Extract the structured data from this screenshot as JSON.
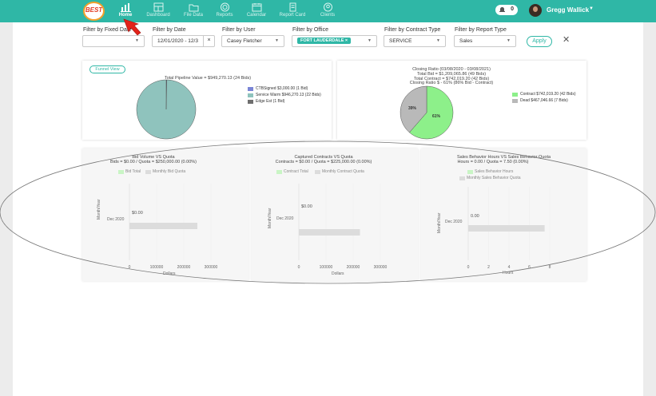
{
  "app": {
    "logo_text": "BEST",
    "nav": [
      {
        "label": "Home",
        "icon": "home-chart-icon",
        "active": true
      },
      {
        "label": "Dashboard",
        "icon": "dashboard-icon"
      },
      {
        "label": "File Data",
        "icon": "folder-icon"
      },
      {
        "label": "Reports",
        "icon": "reports-icon"
      },
      {
        "label": "Calendar",
        "icon": "calendar-icon"
      },
      {
        "label": "Report Card",
        "icon": "report-card-icon"
      },
      {
        "label": "Clients",
        "icon": "clients-icon"
      }
    ],
    "notifications_count": "0",
    "user_name": "Gregg Wallick",
    "colors": {
      "accent": "#2fb7a6",
      "service_warm": "#8fc3bd",
      "contract": "#8df08a",
      "dead": "#b9b9b9",
      "ctb": "#7a85d6",
      "edge": "#6e6e6e"
    }
  },
  "filters": {
    "fixed_date": {
      "label": "Filter by Fixed Date",
      "value": ""
    },
    "date": {
      "label": "Filter by Date",
      "value": "12/01/2020 - 12/3",
      "clear": "×"
    },
    "user": {
      "label": "Filter by User",
      "value": "Casey Fletcher"
    },
    "office": {
      "label": "Filter by Office",
      "tag": "FORT LAUDERDALE",
      "tag_remove": "×"
    },
    "contract_type": {
      "label": "Filter by Contract Type",
      "value": "SERVICE"
    },
    "report_type": {
      "label": "Filter by Report Type",
      "value": "Sales"
    },
    "apply_label": "Apply",
    "close_label": "✕"
  },
  "funnel_label": "Funnel View",
  "pipeline": {
    "title": "Total Pipeline Value = $949,270.13 (24 Bids)",
    "legend": [
      "CTBSigned $3,000.00 (1 Bid)",
      "Service Warm  $946,270.13 (22 Bids)",
      "Edge Est  (1 Bid)"
    ]
  },
  "closing": {
    "title_lines": [
      "Closing Ratio (03/08/2020 - 03/08/2021)",
      "Total Bid = $1,209,065.86 (49 Bids)",
      "Total Contract = $742,019.20 (42 Bids)",
      "Closing Ratio $ - 61% (86% Bid - Contract)"
    ],
    "legend": [
      "Contract $742,019.20 (42 Bids)",
      "Dead $467,046.66 (7 Bids)"
    ],
    "pct_contract": "61%",
    "pct_dead": "39%"
  },
  "chart_data": [
    {
      "type": "pie",
      "categories": [
        "CTBSigned",
        "Service Warm",
        "Edge Est"
      ],
      "values": [
        3000.0,
        946270.13,
        0
      ],
      "title": "Total Pipeline Value = $949,270.13 (24 Bids)"
    },
    {
      "type": "pie",
      "categories": [
        "Contract",
        "Dead"
      ],
      "values": [
        742019.2,
        467046.66
      ],
      "title": "Closing Ratio (03/08/2020 - 03/08/2021)"
    },
    {
      "type": "bar",
      "title": "Bid Volume VS Quota",
      "subtitle": "Bids = $0.00 / Quota = $250,000.00 (0.00%)",
      "categories": [
        "Dec 2020"
      ],
      "series": [
        {
          "name": "Bid Total",
          "values": [
            0
          ]
        },
        {
          "name": "Monthly Bid Quota",
          "values": [
            250000
          ]
        }
      ],
      "value_labels": [
        "$0.00",
        "$250,000.00"
      ],
      "xlabel": "Dollars",
      "ylabel": "Month/Year",
      "xticks": [
        "0",
        "100000",
        "200000",
        "300000"
      ],
      "xlim": [
        0,
        300000
      ]
    },
    {
      "type": "bar",
      "title": "Captured Contracts VS Quota",
      "subtitle": "Contracts = $0.00 / Quota = $225,000.00 (0.00%)",
      "categories": [
        "Dec 2020"
      ],
      "series": [
        {
          "name": "Contract Total",
          "values": [
            0
          ]
        },
        {
          "name": "Monthly Contract Quota",
          "values": [
            225000
          ]
        }
      ],
      "value_labels": [
        "$0.00",
        "$225,000.00"
      ],
      "xlabel": "Dollars",
      "ylabel": "Month/Year",
      "xticks": [
        "0",
        "100000",
        "200000",
        "300000"
      ],
      "xlim": [
        0,
        300000
      ]
    },
    {
      "type": "bar",
      "title": "Sales Behavior Hours VS Sales Behavior Quota",
      "subtitle": "Hours = 0.00 / Quota = 7.50 (0.00%)",
      "categories": [
        "Dec 2020"
      ],
      "series": [
        {
          "name": "Sales Behavior Hours",
          "values": [
            0
          ]
        },
        {
          "name": "Monthly Sales Behavior Quota",
          "values": [
            7.5
          ]
        }
      ],
      "value_labels": [
        "0.00",
        "7.5"
      ],
      "xlabel": "Hours",
      "ylabel": "Month/Year",
      "xticks": [
        "0",
        "2",
        "4",
        "6",
        "8"
      ],
      "xlim": [
        0,
        8
      ]
    }
  ]
}
